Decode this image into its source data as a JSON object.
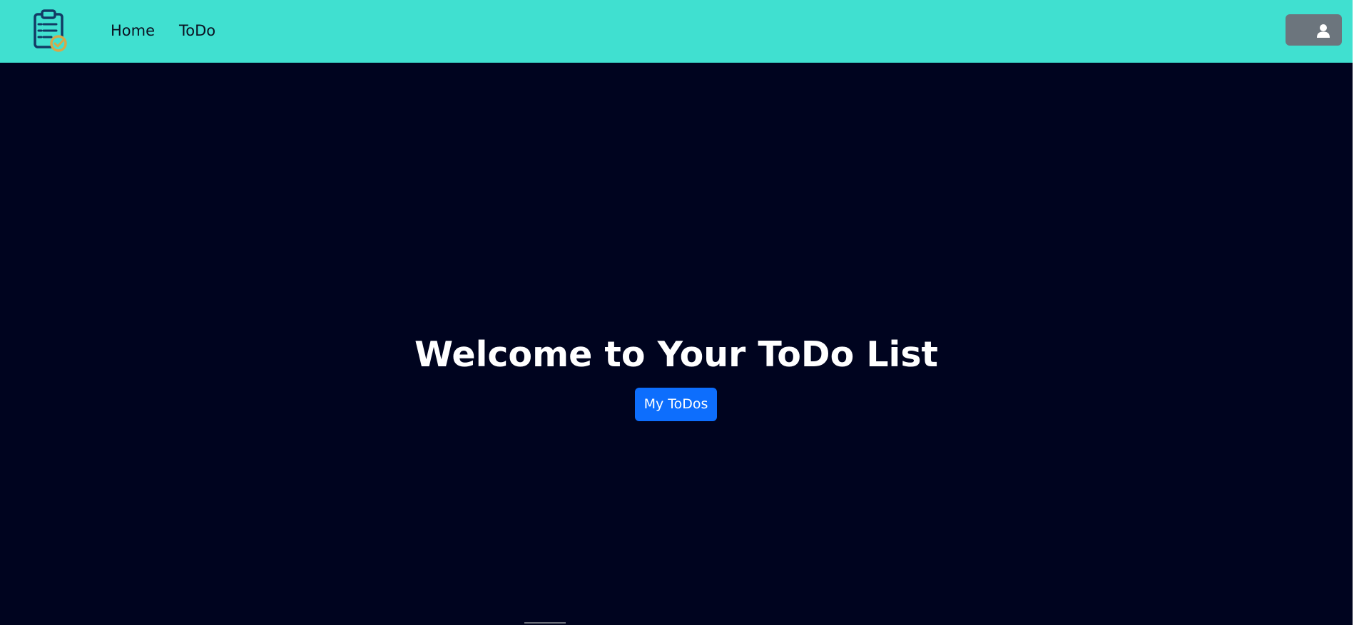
{
  "navbar": {
    "logo_icon": "clipboard-check-icon",
    "links": [
      {
        "label": "Home"
      },
      {
        "label": "ToDo"
      }
    ],
    "user_button_icon": "user-icon",
    "background": "#40e0d0"
  },
  "hero": {
    "title": "Welcome to Your ToDo List",
    "button_label": "My ToDos",
    "background": "#00041f",
    "button_color": "#0d6efd"
  }
}
